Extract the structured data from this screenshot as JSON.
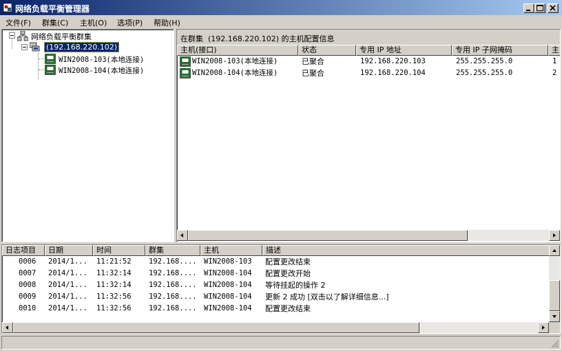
{
  "window": {
    "title": "网络负载平衡管理器"
  },
  "menu": [
    "文件(F)",
    "群集(C)",
    "主机(O)",
    "选项(P)",
    "帮助(H)"
  ],
  "tree": {
    "root": "网络负载平衡群集",
    "cluster": "(192.168.220.102)",
    "hosts": [
      "WIN2008-103(本地连接)",
      "WIN2008-104(本地连接)"
    ]
  },
  "detail": {
    "caption": "在群集  (192.168.220.102) 的主机配置信息",
    "columns": [
      "主机(接口)",
      "状态",
      "专用 IP 地址",
      "专用 IP 子网掩码",
      "主"
    ],
    "rows": [
      [
        "WIN2008-103(本地连接)",
        "已聚合",
        "192.168.220.103",
        "255.255.255.0",
        "1"
      ],
      [
        "WIN2008-104(本地连接)",
        "已聚合",
        "192.168.220.104",
        "255.255.255.0",
        "2"
      ]
    ]
  },
  "log": {
    "columns": [
      "日志项目",
      "日期",
      "时间",
      "群集",
      "主机",
      "描述"
    ],
    "rows": [
      [
        "0006",
        "2014/1...",
        "11:21:52",
        "192.168....",
        "WIN2008-103",
        "配置更改结束"
      ],
      [
        "0007",
        "2014/1...",
        "11:32:14",
        "192.168....",
        "WIN2008-104",
        "配置更改开始"
      ],
      [
        "0008",
        "2014/1...",
        "11:32:14",
        "192.168....",
        "WIN2008-104",
        "等待挂起的操作 2"
      ],
      [
        "0009",
        "2014/1...",
        "11:32:56",
        "192.168....",
        "WIN2008-104",
        "更新 2 成功 [双击以了解详细信息...]"
      ],
      [
        "0010",
        "2014/1...",
        "11:32:56",
        "192.168....",
        "WIN2008-104",
        "配置更改结束"
      ]
    ]
  },
  "icons": {
    "app": "nlb-manager-icon",
    "minimize": "minimize-icon",
    "maximize": "maximize-icon",
    "close": "close-icon",
    "host": "server-computer-icon",
    "cluster": "network-cluster-icon"
  },
  "colors": {
    "titlebar_start": "#0a246a",
    "titlebar_end": "#a6caf0",
    "selection": "#0a246a",
    "host_icon": "#1e8a2e"
  }
}
